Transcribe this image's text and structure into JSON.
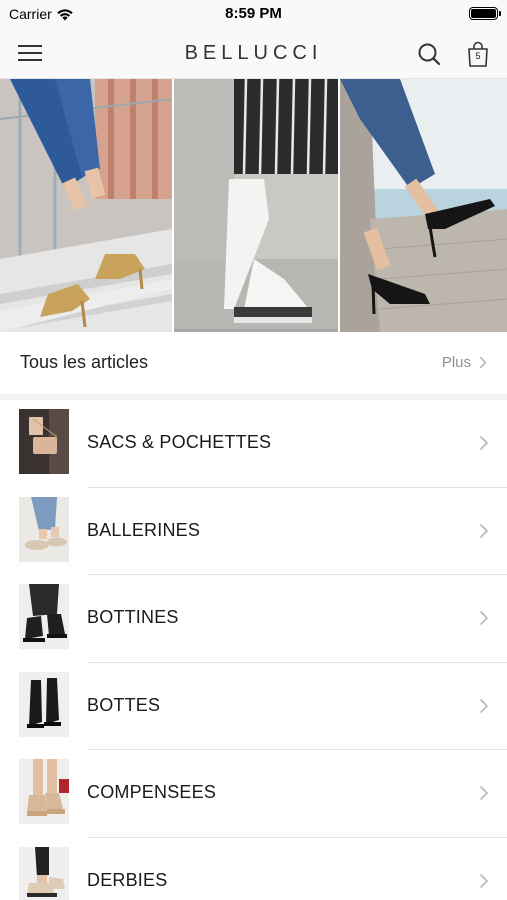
{
  "status_bar": {
    "carrier": "Carrier",
    "time": "8:59 PM"
  },
  "nav": {
    "brand": "BELLUCCI",
    "cart_count": "5"
  },
  "hero": {
    "panels": [
      "gold-sandals-on-stairs",
      "white-platform-sneakers",
      "black-pumps-on-wall"
    ]
  },
  "all_articles": {
    "title": "Tous les articles",
    "more_label": "Plus"
  },
  "categories": [
    {
      "label": "SACS & POCHETTES",
      "thumb": "bag"
    },
    {
      "label": "BALLERINES",
      "thumb": "ballerina"
    },
    {
      "label": "BOTTINES",
      "thumb": "ankle-boot"
    },
    {
      "label": "BOTTES",
      "thumb": "tall-boot"
    },
    {
      "label": "COMPENSEES",
      "thumb": "wedge"
    },
    {
      "label": "DERBIES",
      "thumb": "derby"
    }
  ],
  "colors": {
    "bar_background": "#f9f9f9",
    "text_primary": "#1a1a1a",
    "text_secondary": "#8e8e93",
    "chevron": "#b8b8bd"
  }
}
